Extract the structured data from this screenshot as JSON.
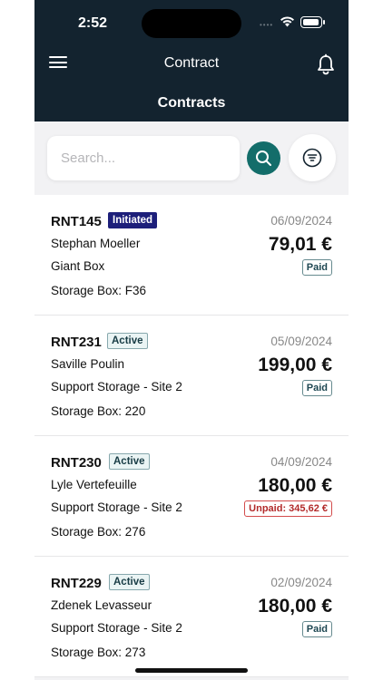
{
  "status_bar": {
    "time": "2:52"
  },
  "header": {
    "app_title": "Contract",
    "page_title": "Contracts"
  },
  "search": {
    "placeholder": "Search..."
  },
  "icons": {
    "menu": "hamburger-menu-icon",
    "notifications": "bell-icon",
    "search": "search-icon",
    "filter": "filter-icon"
  },
  "colors": {
    "header_bg": "#13232f",
    "accent": "#136d6a",
    "initiated_badge": "#1d1f7a",
    "unpaid": "#d34b4b"
  },
  "contracts": [
    {
      "ref": "RNT145",
      "status": "Initiated",
      "name": "Stephan Moeller",
      "site": "Giant Box",
      "box": "Storage Box: F36",
      "date": "06/09/2024",
      "amount": "79,01 €",
      "payment": "Paid"
    },
    {
      "ref": "RNT231",
      "status": "Active",
      "name": "Saville Poulin",
      "site": "Support Storage - Site 2",
      "box": "Storage Box: 220",
      "date": "05/09/2024",
      "amount": "199,00 €",
      "payment": "Paid"
    },
    {
      "ref": "RNT230",
      "status": "Active",
      "name": "Lyle Vertefeuille",
      "site": "Support Storage - Site 2",
      "box": "Storage Box: 276",
      "date": "04/09/2024",
      "amount": "180,00 €",
      "payment": "Unpaid: 345,62 €"
    },
    {
      "ref": "RNT229",
      "status": "Active",
      "name": "Zdenek Levasseur",
      "site": "Support Storage - Site 2",
      "box": "Storage Box: 273",
      "date": "02/09/2024",
      "amount": "180,00 €",
      "payment": "Paid"
    }
  ]
}
